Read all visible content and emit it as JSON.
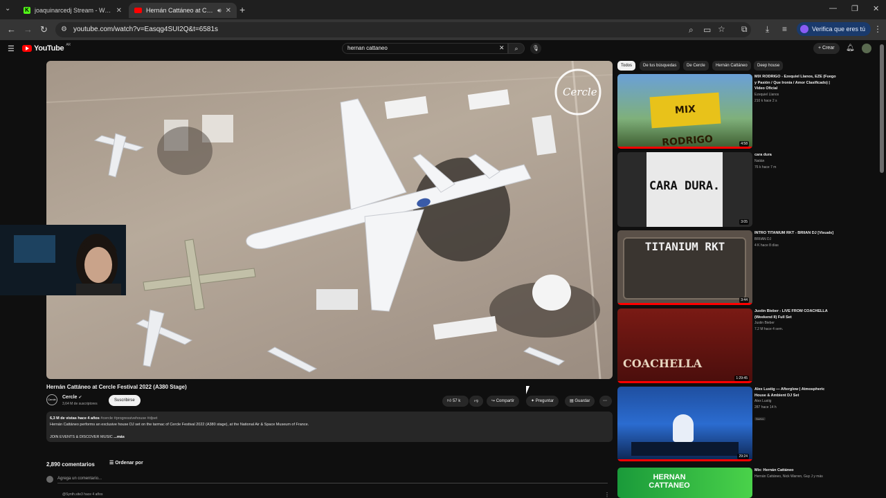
{
  "browser": {
    "tabs": [
      {
        "label": "joaquinarcedj Stream - Watch L",
        "close": "✕"
      },
      {
        "label": "Hernán Cattáneo at Cercle F",
        "close": "✕"
      }
    ],
    "new_tab": "+",
    "url": "youtube.com/watch?v=Easqg4SUI2Q&t=6581s",
    "verify_label": "Verifica que eres tú"
  },
  "youtube": {
    "logo": "YouTube",
    "logo_country": "AR",
    "search_value": "hernan cattaneo",
    "create_label": "Crear"
  },
  "video": {
    "title": "Hernán Cattáneo at Cercle Festival 2022 (A380 Stage)",
    "channel": "Cercle",
    "channel_logo_text": "Cercle",
    "subscribers": "3,64 M de suscriptores",
    "subscribe_label": "Suscribirse",
    "likes": "57 k",
    "share_label": "Compartir",
    "ask_label": "Preguntar",
    "save_label": "Guardar",
    "watermark": "Cercle"
  },
  "description": {
    "views": "6,3 M de vistas",
    "date": "hace 4 años",
    "tags": "#cercle #progressivehouse #djset",
    "text": "Hernán Cattáneo performs an exclusive house DJ set on the tarmac of Cercle Festival 2022 (A380 stage), at the National Air & Space Museum of France.",
    "join": "JOIN EVENTS & DISCOVER MUSIC",
    "more": "...más"
  },
  "comments": {
    "count": "2,890 comentarios",
    "sort_label": "Ordenar por",
    "add_placeholder": "Agrega un comentario...",
    "next_author": "@Synth.site3 hace 4 años"
  },
  "chips": [
    "Todos",
    "De tus búsquedas",
    "De Cercle",
    "Hernán Cattáneo",
    "Deep house"
  ],
  "recommendations": [
    {
      "title": "MIX RODRIGO - Ezequiel Llanos, EZE (Fuego y Pasión / Que Ironía / Amor Clasificado) | Video Oficial",
      "channel": "Ezequiel Llanos",
      "meta": "210 k  hace 2 s",
      "duration": "4:58",
      "thumb_text": "MIX RODRIGO"
    },
    {
      "title": "cara dura",
      "channel": "Natián",
      "meta": "76 k  hace 7 m",
      "duration": "3:05",
      "thumb_text": "CARA DURA."
    },
    {
      "title": "INTRO TITANIUM RKT - BRIIAN DJ [Visuals]",
      "channel": "BRIIAN DJ",
      "meta": "4 K  hace 8 días",
      "duration": "3:44",
      "thumb_text": "TITANIUM RKT"
    },
    {
      "title": "Justin Bieber - LIVE FROM COACHELLA (Weekend II) Full Set",
      "channel": "Justin Bieber",
      "meta": "7.2 M  hace 4 sem.",
      "duration": "1:29:45",
      "thumb_text": "COACHELLA"
    },
    {
      "title": "Alex Lustig — Afterglow | Atmospheric House & Ambient DJ Set",
      "channel": "Alex Lustig",
      "meta": "287  hace 14 h",
      "badge": "Nuevo",
      "duration": "29:24"
    },
    {
      "title": "Mix: Hernán Cattáneo",
      "channel": "Hernán Cattáneo, Nick Warren, Guy J y más",
      "meta": "",
      "duration": "",
      "thumb_text": "HERNAN CATTANEO"
    }
  ]
}
